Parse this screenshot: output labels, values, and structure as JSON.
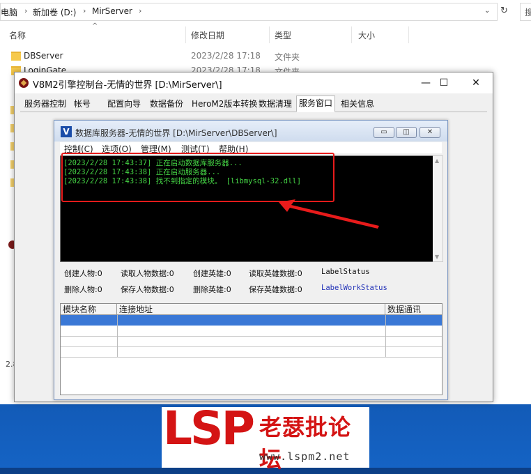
{
  "explorer": {
    "breadcrumb": [
      "电脑",
      "新加卷 (D:)",
      "MirServer"
    ],
    "search_partial": "搜",
    "columns": {
      "name": "名称",
      "modified": "修改日期",
      "type": "类型",
      "size": "大小"
    },
    "rows": [
      {
        "name": "DBServer",
        "modified": "2023/2/28 17:18",
        "type": "文件夹"
      },
      {
        "name": "LoginGate",
        "modified": "2023/2/28 17:18",
        "type": "文件夹"
      }
    ],
    "left_partial_text": "2.8"
  },
  "console": {
    "title": "V8M2引擎控制台-无情的世界 [D:\\MirServer\\]",
    "tabs": [
      "服务器控制",
      "帐号",
      "配置向导",
      "数据备份",
      "HeroM2版本转换",
      "数据清理",
      "服务窗口",
      "相关信息"
    ],
    "active_tab": "服务窗口",
    "min": "—",
    "max": "☐",
    "close": "✕"
  },
  "dbserver": {
    "logo": "V",
    "title": "数据库服务器-无情的世界  [D:\\MirServer\\DBServer\\]",
    "menu": [
      "控制(C)",
      "选项(O)",
      "管理(M)",
      "测试(T)",
      "帮助(H)"
    ],
    "log": [
      "[2023/2/28 17:43:37] 正在启动数据库服务器...",
      "[2023/2/28 17:43:38] 正在启动服务器...",
      "[2023/2/28 17:43:38] 找不到指定的模块。 [libmysql-32.dll]"
    ],
    "stats_row1": [
      "创建人物:0",
      "读取人物数据:0",
      "创建英雄:0",
      "读取英雄数据:0",
      "LabelStatus"
    ],
    "stats_row2": [
      "删除人物:0",
      "保存人物数据:0",
      "删除英雄:0",
      "保存英雄数据:0",
      "LabelWorkStatus"
    ],
    "grid_headers": [
      "模块名称",
      "连接地址",
      "数据通讯"
    ]
  },
  "watermark": {
    "logo": "LSP",
    "name": "老瑟批论坛",
    "url": "www.lspm2.net"
  },
  "colors": {
    "highlight": "#e81b1b",
    "log_text": "#45d445",
    "selection": "#3a78d6",
    "desktop": "#0d4a9e"
  }
}
